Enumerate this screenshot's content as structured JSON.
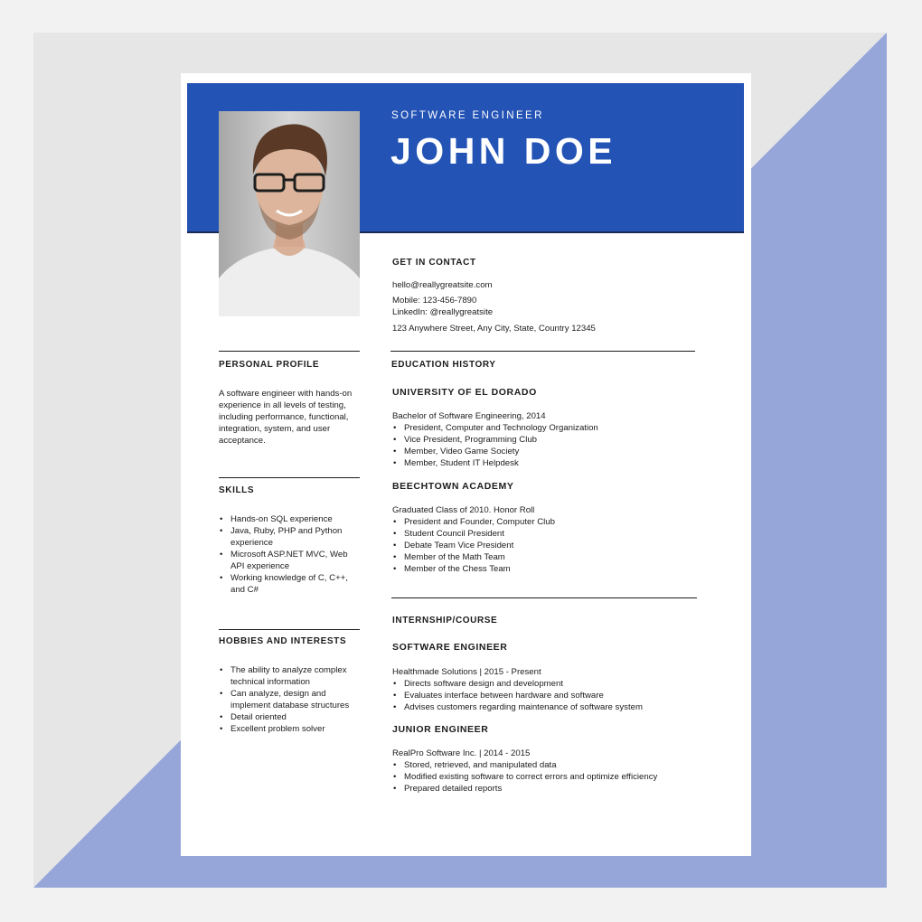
{
  "colors": {
    "accent": "#2353b5",
    "background_shape": "#97a6d9"
  },
  "header": {
    "subtitle": "SOFTWARE ENGINEER",
    "name": "JOHN DOE"
  },
  "photo": {
    "alt": "Portrait photo"
  },
  "contact": {
    "title": "GET IN CONTACT",
    "email": "hello@reallygreatsite.com",
    "mobile": "Mobile: 123-456-7890",
    "linkedin": "LinkedIn: @reallygreatsite",
    "address": "123 Anywhere Street, Any City, State, Country 12345"
  },
  "profile": {
    "title": "PERSONAL PROFILE",
    "lines": [
      "A software engineer with hands-on",
      "experience in all levels of testing,",
      "including performance, functional,",
      "integration, system, and user",
      "acceptance."
    ]
  },
  "skills": {
    "title": "SKILLS",
    "items": [
      [
        "Hands-on SQL experience"
      ],
      [
        "Java, Ruby, PHP and Python",
        "experience"
      ],
      [
        "Microsoft ASP.NET MVC, Web",
        "API experience"
      ],
      [
        "Working knowledge of C, C++,",
        "and C#"
      ]
    ]
  },
  "hobbies": {
    "title": "HOBBIES AND INTERESTS",
    "items": [
      [
        "The ability to analyze complex",
        "technical information"
      ],
      [
        "Can analyze, design and",
        "implement database structures"
      ],
      [
        "Detail oriented"
      ],
      [
        "Excellent problem solver"
      ]
    ]
  },
  "education": {
    "title": "EDUCATION HISTORY",
    "schools": [
      {
        "name": "UNIVERSITY OF EL DORADO",
        "detail": "Bachelor of Software Engineering, 2014",
        "items": [
          "President, Computer and Technology Organization",
          "Vice President, Programming Club",
          "Member, Video Game Society",
          "Member, Student IT Helpdesk"
        ]
      },
      {
        "name": "BEECHTOWN ACADEMY",
        "detail": "Graduated Class of 2010. Honor Roll",
        "items": [
          "President and Founder, Computer Club",
          "Student Council President",
          "Debate Team Vice President",
          "Member of the Math Team",
          "Member of the Chess Team"
        ]
      }
    ]
  },
  "internship": {
    "title": "INTERNSHIP/COURSE",
    "jobs": [
      {
        "title": "SOFTWARE ENGINEER",
        "detail": "Healthmade Solutions | 2015 - Present",
        "items": [
          "Directs software design and development",
          "Evaluates interface between hardware and software",
          "Advises customers regarding maintenance of software system"
        ]
      },
      {
        "title": "JUNIOR ENGINEER",
        "detail": "RealPro Software Inc. | 2014 - 2015",
        "items": [
          "Stored, retrieved, and manipulated data",
          "Modified existing software to correct errors and optimize efficiency",
          "Prepared detailed reports"
        ]
      }
    ]
  }
}
